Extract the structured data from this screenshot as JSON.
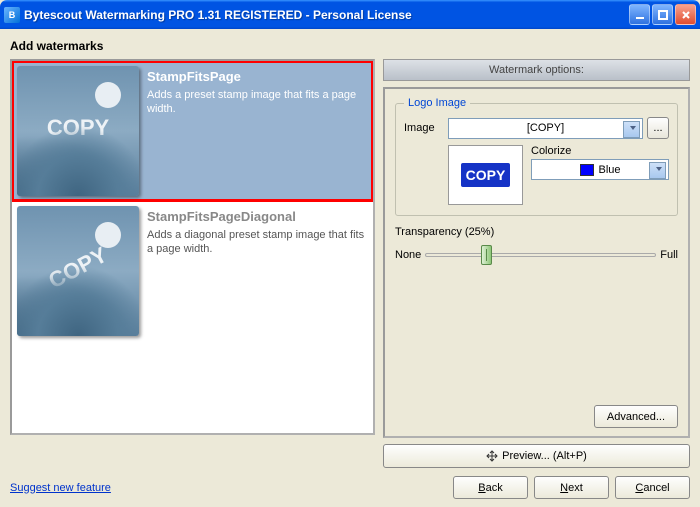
{
  "window": {
    "title": "Bytescout Watermarking PRO 1.31 REGISTERED - Personal License",
    "icon_letter": "B"
  },
  "heading": "Add watermarks",
  "presets": [
    {
      "title": "StampFitsPage",
      "desc": "Adds a preset stamp image that fits a page width.",
      "thumb_text": "COPY",
      "selected": true,
      "diagonal": false
    },
    {
      "title": "StampFitsPageDiagonal",
      "desc": "Adds a diagonal preset stamp image that fits a page width.",
      "thumb_text": "COPY",
      "selected": false,
      "diagonal": true
    }
  ],
  "options": {
    "header": "Watermark options:",
    "logo_legend": "Logo Image",
    "image_label": "Image",
    "image_value": "[COPY]",
    "browse_btn": "...",
    "preview_text": "COPY",
    "colorize_label": "Colorize",
    "color_name": "Blue",
    "transparency_label": "Transparency (25%)",
    "none_label": "None",
    "full_label": "Full",
    "advanced_btn": "Advanced...",
    "preview_btn": "Preview... (Alt+P)"
  },
  "footer": {
    "link": "Suggest new feature",
    "back": "Back",
    "next": "Next",
    "cancel": "Cancel"
  }
}
